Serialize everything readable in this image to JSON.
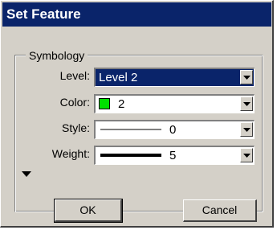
{
  "window": {
    "title": "Set Feature"
  },
  "group": {
    "label": "Symbology"
  },
  "fields": {
    "level": {
      "label": "Level:",
      "value": "Level 2"
    },
    "color": {
      "label": "Color:",
      "value": "2",
      "swatch_color": "#00e000"
    },
    "style": {
      "label": "Style:",
      "value": "0"
    },
    "weight": {
      "label": "Weight:",
      "value": "5"
    }
  },
  "buttons": {
    "ok": "OK",
    "cancel": "Cancel"
  },
  "icons": {
    "dropdown": "chevron-down-icon",
    "expander": "triangle-down-icon"
  }
}
